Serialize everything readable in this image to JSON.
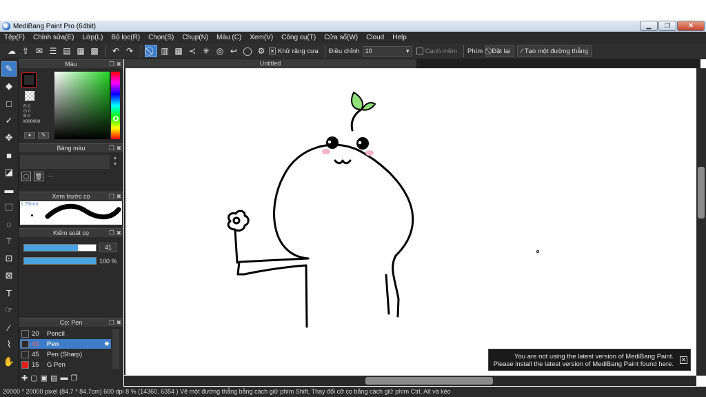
{
  "window": {
    "title": "MediBang Paint Pro (64bit)",
    "controls": {
      "minimize": "▁",
      "maximize": "❐",
      "close": "✕"
    }
  },
  "menu": {
    "items": [
      "Tệp(F)",
      "Chỉnh sửa(E)",
      "Lớp(L)",
      "Bộ lọc(R)",
      "Chọn(S)",
      "Chụp(N)",
      "Màu (C)",
      "Xem(V)",
      "Công cụ(T)",
      "Cửa sổ(W)",
      "Cloud",
      "Help"
    ]
  },
  "toolbar": {
    "antialias_label": "Khử răng cưa",
    "adjust_label": "Điều chỉnh",
    "adjust_value": "10",
    "soft_edge_label": "Cạnh mềm",
    "key_label": "Phím",
    "reset_label": "Đặt lại",
    "create_line_label": "Tạo một đường thẳng"
  },
  "color_panel": {
    "title": "Màu",
    "rgb": "R:0\nG:0\nB:0",
    "hex": "#000000",
    "colors": {
      "foreground": "#000000",
      "accent": "#3e7cc8"
    }
  },
  "palette_panel": {
    "title": "Bảng màu",
    "placeholder": "---"
  },
  "brush_preview_panel": {
    "title": "Xem trước cọ",
    "size_text": "1.76mm"
  },
  "brush_control_panel": {
    "title": "Kiểm soát cọ",
    "size_value": "41",
    "size_fraction": 0.75,
    "opacity_value": "100 %",
    "opacity_fraction": 1.0
  },
  "brush_list_panel": {
    "title": "Cọ: Pen",
    "items": [
      {
        "size": "20",
        "name": "Pencil",
        "color": "#2b2b2b"
      },
      {
        "size": "41",
        "name": "Pen",
        "color": "#2b2b2b"
      },
      {
        "size": "45",
        "name": "Pen (Sharp)",
        "color": "#2b2b2b"
      },
      {
        "size": "15",
        "name": "G Pen",
        "color": "#e02020"
      }
    ]
  },
  "document": {
    "tab_title": "Untitled"
  },
  "notice": {
    "line1": "You are not using the latest version of MediBang Paint.",
    "line2": "Please install the latest version of MediBang Paint found here.",
    "close": "✕"
  },
  "status": {
    "text": "20000 * 20000 pixel  (84.7 * 84.7cm)  600 dpi  8 %  (14360, 6354 )  Vẽ một đường thẳng bằng cách giữ phím Shift, Thay đổi cỡ cọ bằng cách giữ phím Ctrl, Alt và kéo"
  }
}
